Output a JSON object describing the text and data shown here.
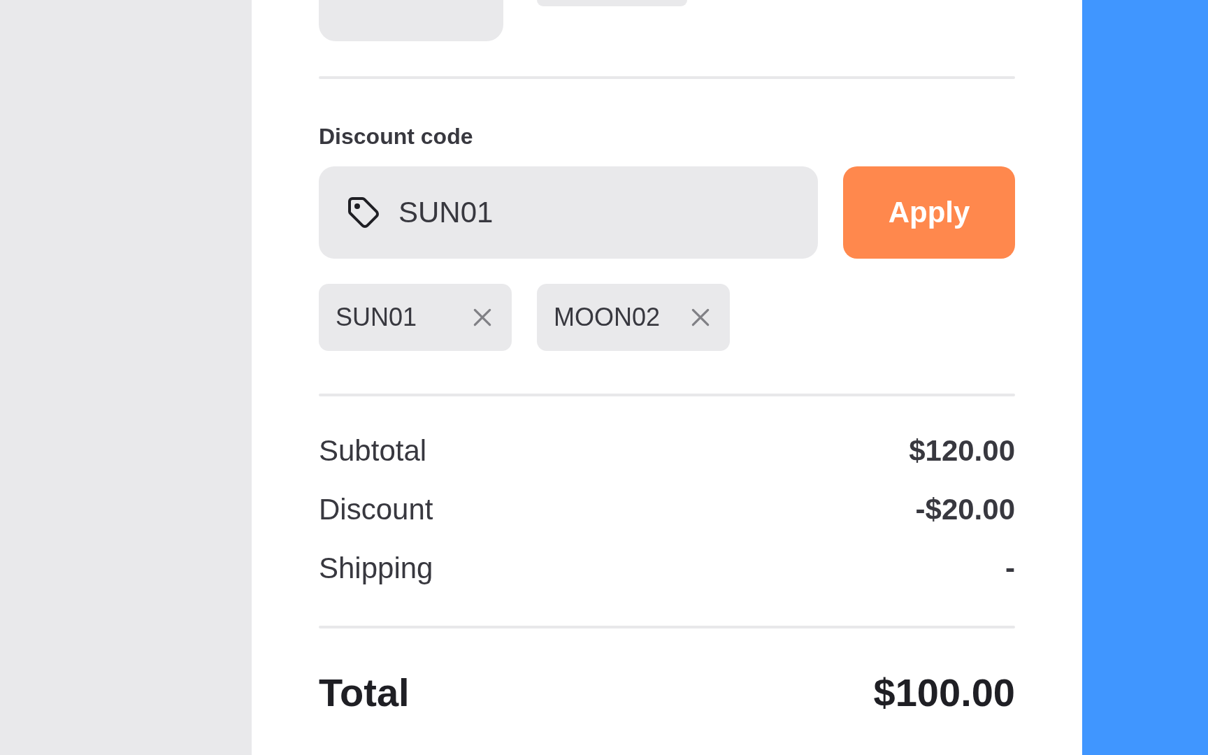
{
  "discount": {
    "label": "Discount code",
    "input_value": "SUN01",
    "apply_button": "Apply",
    "codes": [
      {
        "code": "SUN01"
      },
      {
        "code": "MOON02"
      }
    ]
  },
  "summary": [
    {
      "label": "Subtotal",
      "value": "$120.00"
    },
    {
      "label": "Discount",
      "value": "-$20.00"
    },
    {
      "label": "Shipping",
      "value": "-"
    }
  ],
  "total": {
    "label": "Total",
    "value": "$100.00"
  }
}
